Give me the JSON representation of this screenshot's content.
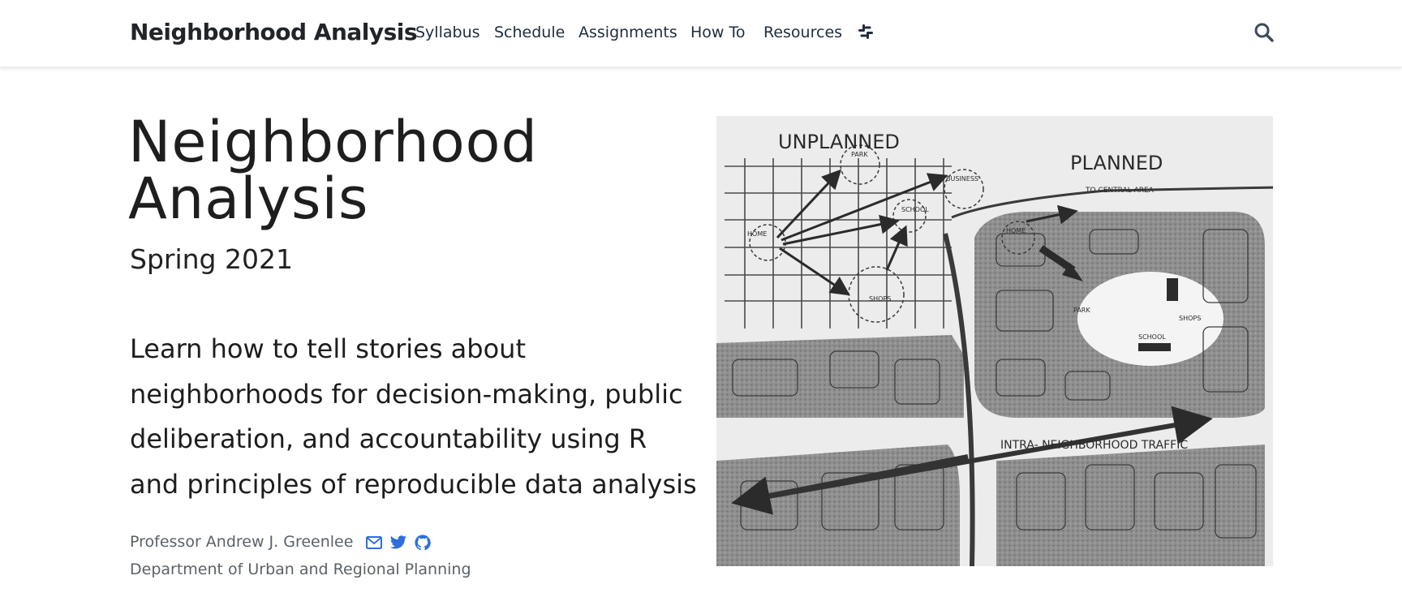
{
  "navbar": {
    "brand": "Neighborhood Analysis",
    "items": [
      {
        "label": "Syllabus"
      },
      {
        "label": "Schedule"
      },
      {
        "label": "Assignments"
      },
      {
        "label": "How To"
      },
      {
        "label": "Resources"
      }
    ],
    "slack_icon": "slack-icon",
    "search_icon": "search-icon"
  },
  "hero": {
    "title": "Neighborhood Analysis",
    "subtitle": "Spring 2021",
    "description": "Learn how to tell stories about neighborhoods for decision-making, public deliberation, and accountability using R and principles of reproducible data analysis",
    "author": "Professor Andrew J. Greenlee",
    "social_icons": [
      "envelope-icon",
      "twitter-icon",
      "github-icon"
    ],
    "department": "Department of Urban and Regional Planning"
  },
  "image": {
    "labels": {
      "unplanned": "UNPLANNED",
      "planned": "PLANNED",
      "to_central": "TO CENTRAL AREA",
      "park": "PARK",
      "business": "BUSINESS",
      "school": "SCHOOL",
      "home": "HOME",
      "shops": "SHOPS",
      "traffic": "INTRA- NEIGHBORHOOD     TRAFFIC"
    }
  },
  "colors": {
    "accent": "#2f6fdb",
    "nav_text": "#1f2d3d",
    "muted": "#5a6268"
  }
}
